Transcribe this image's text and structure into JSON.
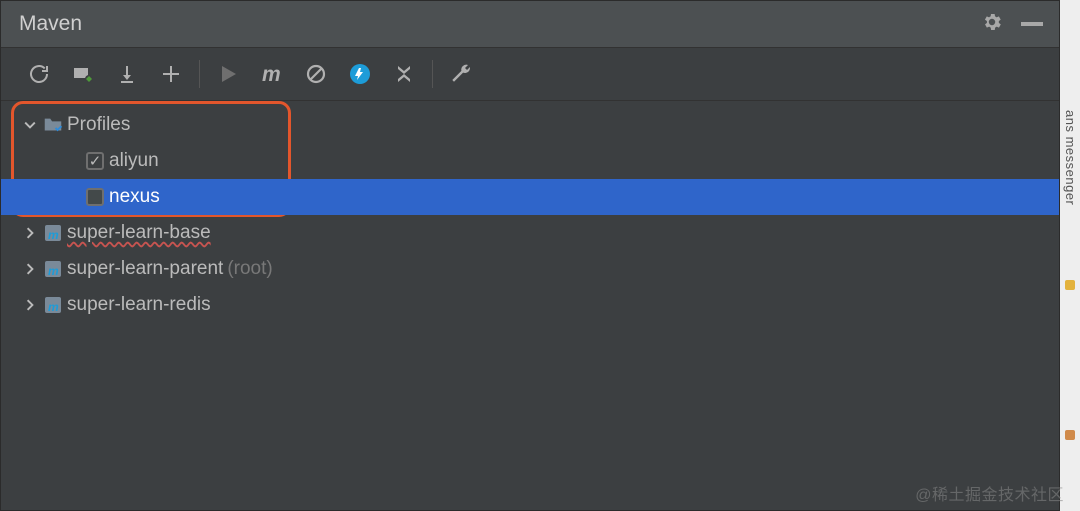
{
  "header": {
    "title": "Maven"
  },
  "toolbar_icons": [
    "reload-icon",
    "reimport-icon",
    "download-icon",
    "add-icon",
    "sep",
    "run-icon",
    "m-icon",
    "skip-tests-icon",
    "offline-icon",
    "collapse-icon",
    "sep",
    "wrench-icon"
  ],
  "tree": {
    "profiles_label": "Profiles",
    "items": [
      {
        "label": "aliyun",
        "checked": true
      },
      {
        "label": "nexus",
        "checked": false
      }
    ],
    "modules": [
      {
        "label": "super-learn-base",
        "suffix": "",
        "error": true
      },
      {
        "label": "super-learn-parent",
        "suffix": "(root)",
        "error": false
      },
      {
        "label": "super-learn-redis",
        "suffix": "",
        "error": false
      }
    ]
  },
  "watermark": "@稀土掘金技术社区",
  "right_tabs": {
    "t1": "ans messenger"
  }
}
